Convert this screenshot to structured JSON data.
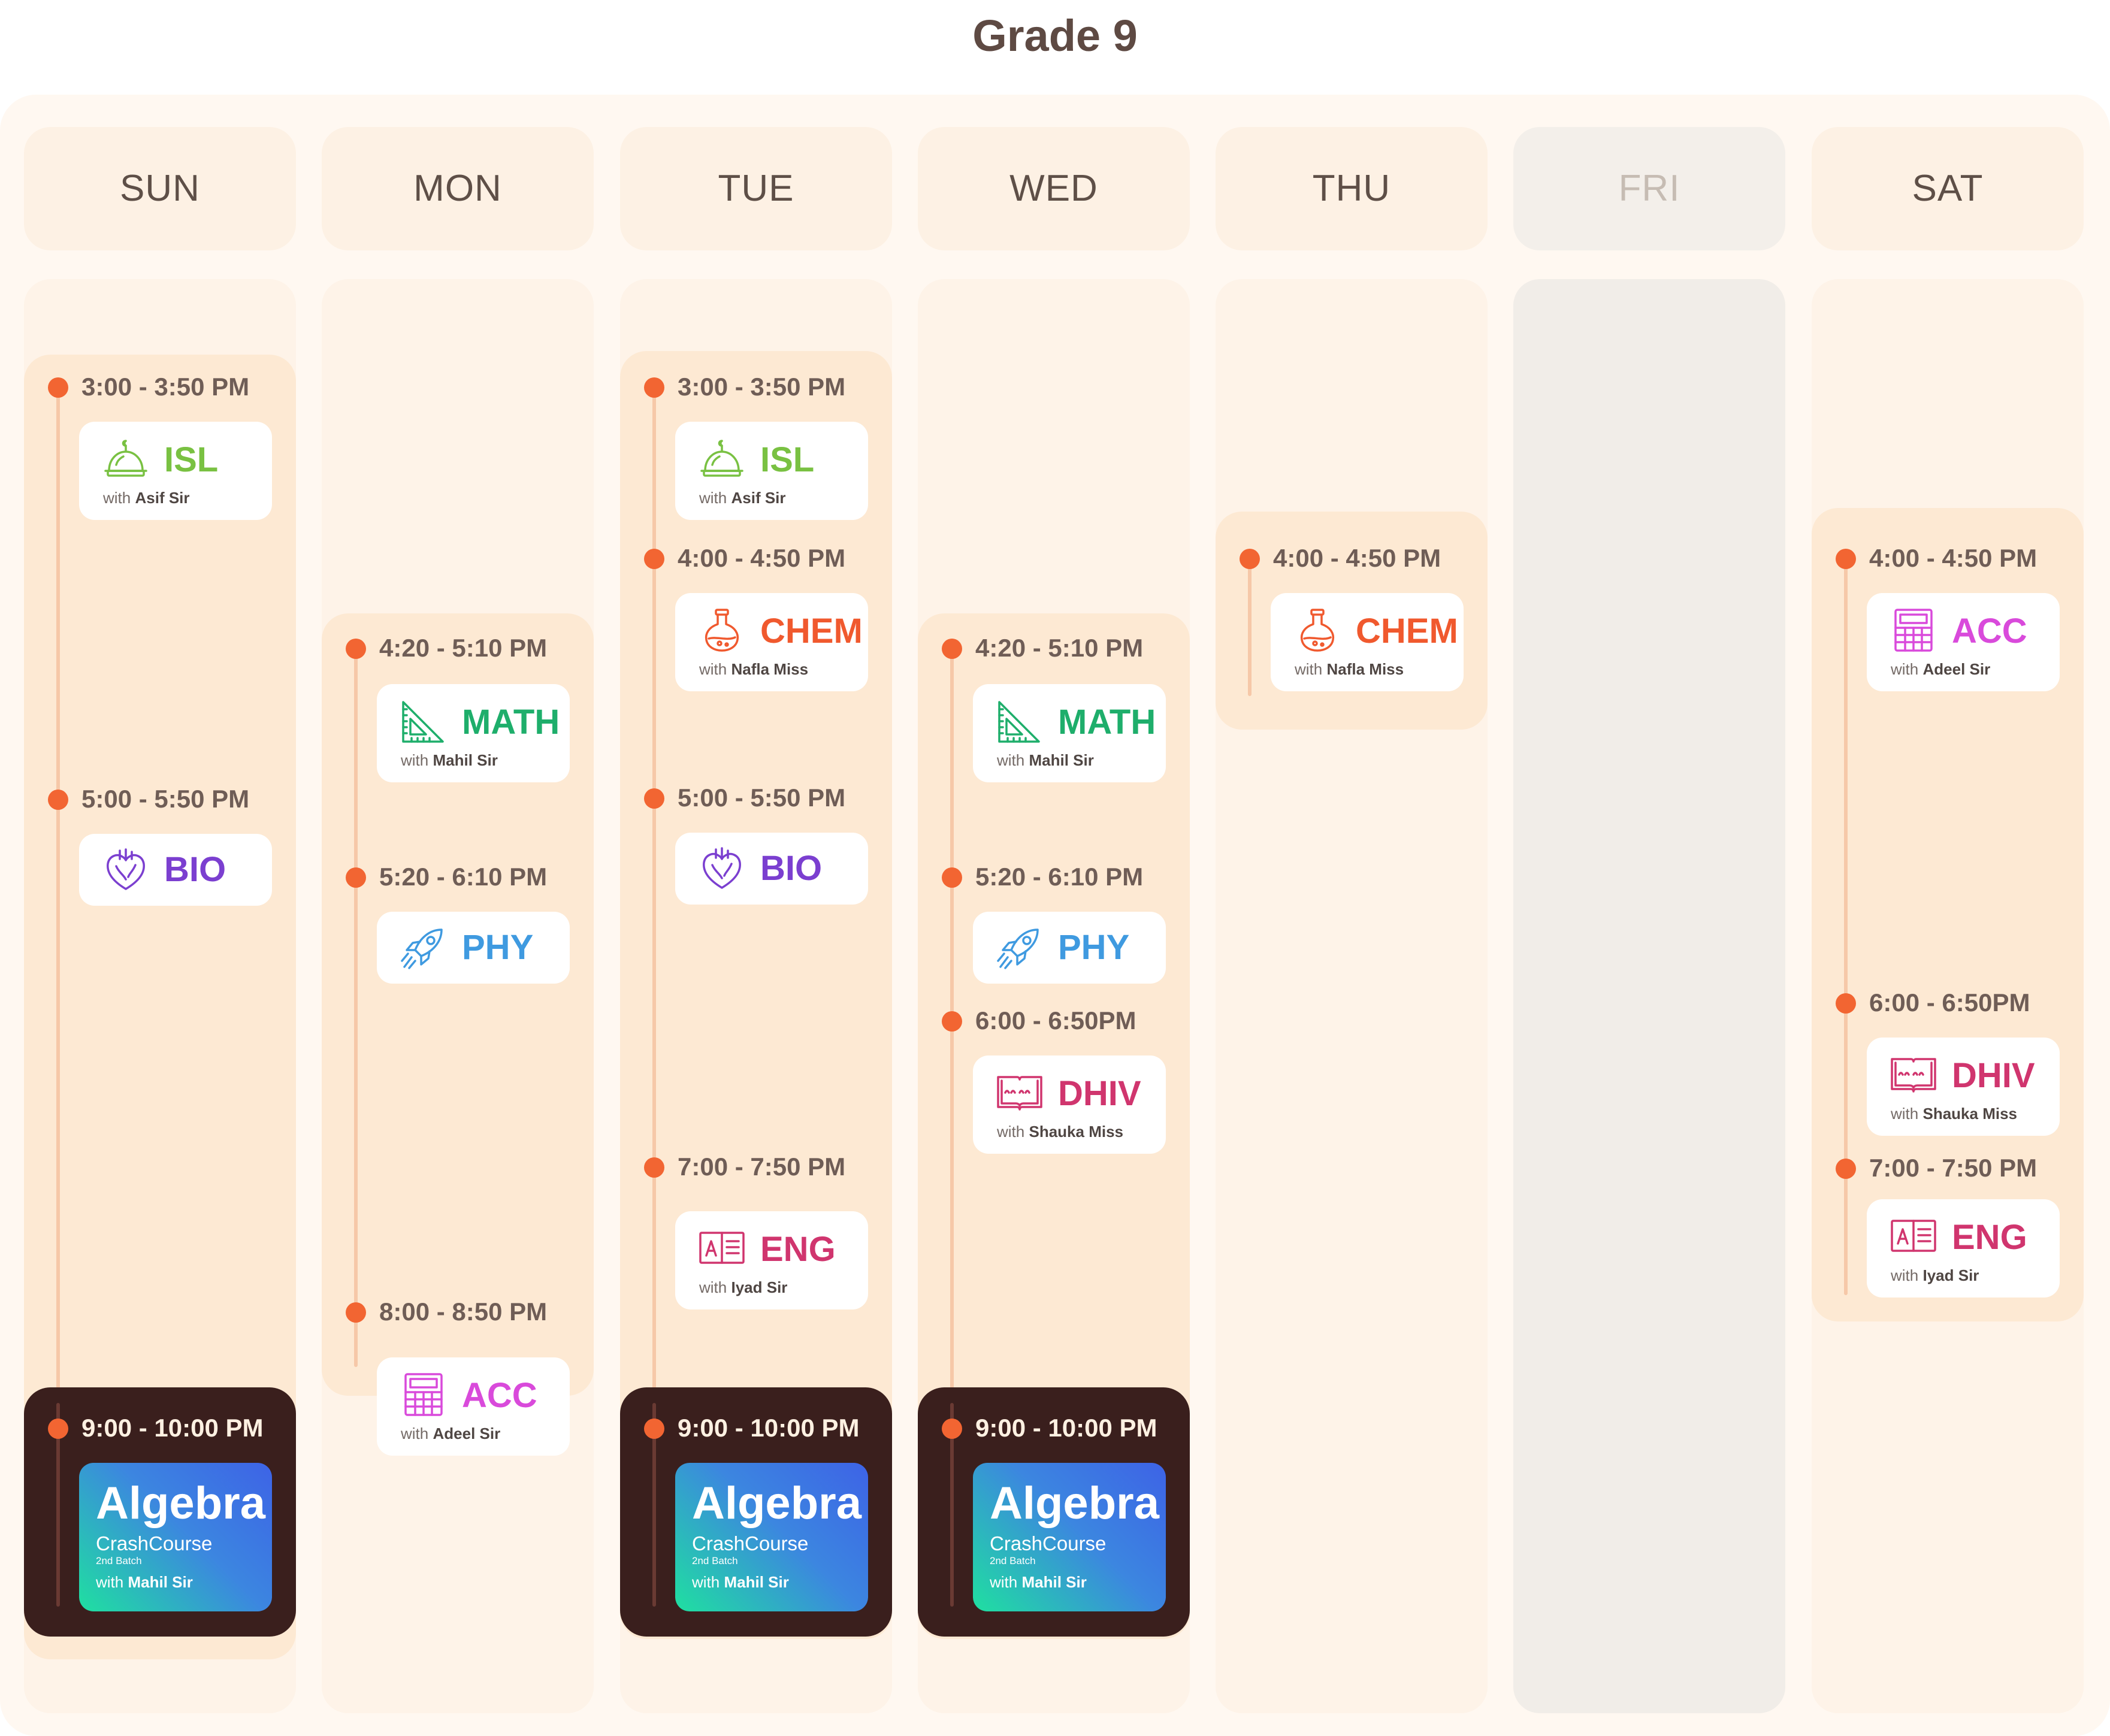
{
  "page": {
    "title": "Grade 9"
  },
  "days": [
    {
      "label": "SUN",
      "slots": [
        {
          "time": "3:00 - 3:50 PM",
          "subject": "ISL",
          "with": "with",
          "teacher": "Asif Sir"
        },
        {
          "time": "5:00 - 5:50 PM",
          "subject": "BIO",
          "with": "",
          "teacher": ""
        }
      ],
      "special": {
        "time": "9:00 - 10:00 PM",
        "title": "Algebra",
        "subtitle": "CrashCourse",
        "batch": "2nd Batch",
        "with": "with",
        "teacher": "Mahil Sir"
      }
    },
    {
      "label": "MON",
      "slots": [
        {
          "time": "4:20 - 5:10 PM",
          "subject": "MATH",
          "with": "with",
          "teacher": "Mahil Sir"
        },
        {
          "time": "5:20 - 6:10 PM",
          "subject": "PHY",
          "with": "",
          "teacher": ""
        },
        {
          "time": "8:00 - 8:50 PM",
          "subject": "ACC",
          "with": "with",
          "teacher": "Adeel Sir"
        }
      ]
    },
    {
      "label": "TUE",
      "slots": [
        {
          "time": "3:00 - 3:50 PM",
          "subject": "ISL",
          "with": "with",
          "teacher": "Asif Sir"
        },
        {
          "time": "4:00 - 4:50 PM",
          "subject": "CHEM",
          "with": "with",
          "teacher": "Nafla Miss"
        },
        {
          "time": "5:00 - 5:50 PM",
          "subject": "BIO",
          "with": "",
          "teacher": ""
        },
        {
          "time": "7:00 - 7:50 PM",
          "subject": "ENG",
          "with": "with",
          "teacher": "Iyad Sir"
        }
      ],
      "special": {
        "time": "9:00 - 10:00 PM",
        "title": "Algebra",
        "subtitle": "CrashCourse",
        "batch": "2nd Batch",
        "with": "with",
        "teacher": "Mahil Sir"
      }
    },
    {
      "label": "WED",
      "slots": [
        {
          "time": "4:20 - 5:10 PM",
          "subject": "MATH",
          "with": "with",
          "teacher": "Mahil Sir"
        },
        {
          "time": "5:20 - 6:10 PM",
          "subject": "PHY",
          "with": "",
          "teacher": ""
        },
        {
          "time": "6:00 - 6:50PM",
          "subject": "DHIV",
          "with": "with",
          "teacher": "Shauka Miss"
        }
      ],
      "special": {
        "time": "9:00 - 10:00 PM",
        "title": "Algebra",
        "subtitle": "CrashCourse",
        "batch": "2nd Batch",
        "with": "with",
        "teacher": "Mahil Sir"
      }
    },
    {
      "label": "THU",
      "slots": [
        {
          "time": "4:00 - 4:50 PM",
          "subject": "CHEM",
          "with": "with",
          "teacher": "Nafla Miss"
        }
      ]
    },
    {
      "label": "FRI",
      "slots": []
    },
    {
      "label": "SAT",
      "slots": [
        {
          "time": "4:00 - 4:50 PM",
          "subject": "ACC",
          "with": "with",
          "teacher": "Adeel Sir"
        },
        {
          "time": "6:00 - 6:50PM",
          "subject": "DHIV",
          "with": "with",
          "teacher": "Shauka Miss"
        },
        {
          "time": "7:00 - 7:50 PM",
          "subject": "ENG",
          "with": "with",
          "teacher": "Iyad Sir"
        }
      ]
    }
  ],
  "subject_styles": {
    "ISL": {
      "color": "#79c142",
      "icon": "mosque-dome-icon"
    },
    "CHEM": {
      "color": "#f0592e",
      "icon": "flask-icon"
    },
    "MATH": {
      "color": "#1eae6b",
      "icon": "set-square-icon"
    },
    "BIO": {
      "color": "#7b3fd0",
      "icon": "heart-icon"
    },
    "PHY": {
      "color": "#3f9ae0",
      "icon": "rocket-icon"
    },
    "ACC": {
      "color": "#d94adb",
      "icon": "calculator-icon"
    },
    "DHIV": {
      "color": "#d0356e",
      "icon": "open-book-icon"
    },
    "ENG": {
      "color": "#d0356e",
      "icon": "alphabet-book-icon"
    }
  },
  "colors": {
    "dot": "#f26532",
    "title": "#5e4a43",
    "dark_block": "#3a1f1d"
  }
}
